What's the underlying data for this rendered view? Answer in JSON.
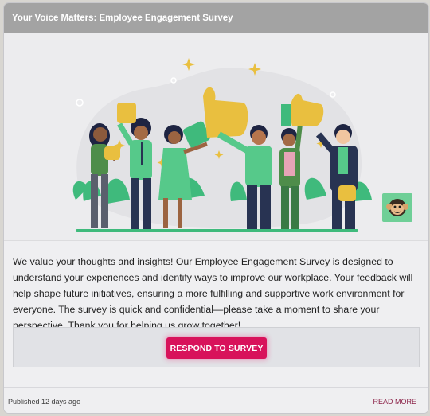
{
  "card": {
    "title": "Your Voice Matters: Employee Engagement Survey",
    "description": "We value your thoughts and insights! Our Employee Engagement Survey is designed to understand your experiences and identify ways to improve our workplace. Your feedback will help shape future initiatives, ensuring a more fulfilling and supportive work environment for everyone. The survey is quick and confidential—please take a moment to share your perspective. Thank you for helping us grow together!",
    "cta_label": "RESPOND TO SURVEY",
    "published": "Published 12 days ago",
    "read_more": "READ MORE"
  },
  "colors": {
    "header_bg": "#a3a3a3",
    "cta": "#d8125b",
    "read_more": "#8a1f45",
    "shirt_green": "#56c98a",
    "thumb_yellow": "#e9bf3f",
    "navy": "#283352"
  },
  "icons": {
    "hero_illustration": "thumbs-up-people-illustration",
    "avatar": "monkey-avatar-icon"
  }
}
